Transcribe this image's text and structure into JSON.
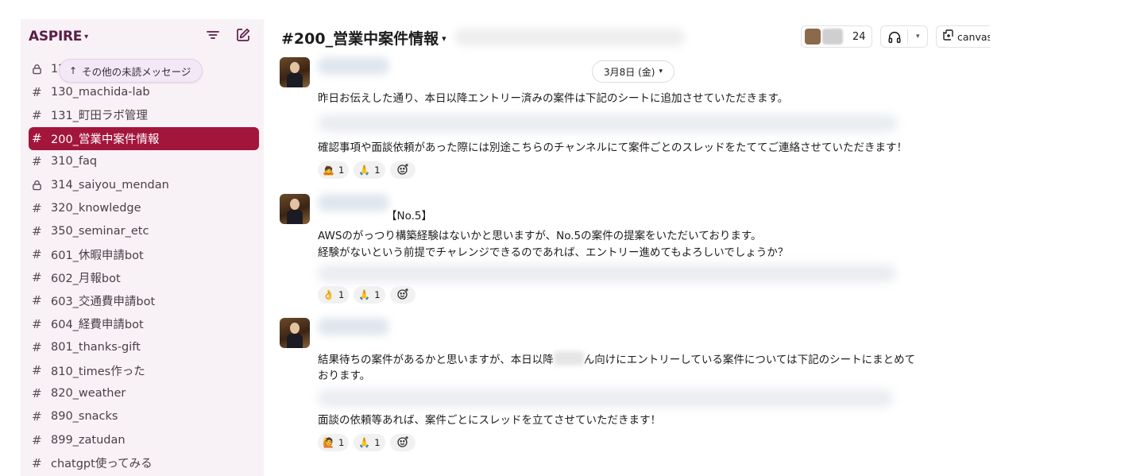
{
  "workspace": {
    "name": "ASPIRE"
  },
  "sidebar": {
    "unread_pill": "その他の未読メッセージ",
    "channels": [
      {
        "label": "12",
        "type": "private"
      },
      {
        "label": "130_machida-lab",
        "type": "public"
      },
      {
        "label": "131_町田ラボ管理",
        "type": "public"
      },
      {
        "label": "200_営業中案件情報",
        "type": "public",
        "active": true
      },
      {
        "label": "310_faq",
        "type": "public"
      },
      {
        "label": "314_saiyou_mendan",
        "type": "private"
      },
      {
        "label": "320_knowledge",
        "type": "public"
      },
      {
        "label": "350_seminar_etc",
        "type": "public"
      },
      {
        "label": "601_休暇申請bot",
        "type": "public"
      },
      {
        "label": "602_月報bot",
        "type": "public"
      },
      {
        "label": "603_交通費申請bot",
        "type": "public"
      },
      {
        "label": "604_経費申請bot",
        "type": "public"
      },
      {
        "label": "801_thanks-gift",
        "type": "public"
      },
      {
        "label": "810_times作った",
        "type": "public"
      },
      {
        "label": "820_weather",
        "type": "public"
      },
      {
        "label": "890_snacks",
        "type": "public"
      },
      {
        "label": "899_zatudan",
        "type": "public"
      },
      {
        "label": "chatgpt使ってみる",
        "type": "public"
      }
    ]
  },
  "header": {
    "hash": "#",
    "channel_name": "200_営業中案件情報",
    "member_count": "24",
    "canvas_label": "canvas"
  },
  "date_divider": "3月8日 (金)",
  "messages": [
    {
      "lines": [
        "昨日お伝えした通り、本日以降エントリー済みの案件は下記のシートに追加させていただきます。",
        "確認事項や面談依頼があった際には別途こちらのチャンネルにて案件ごとのスレッドをたててご連絡させていただきます！"
      ],
      "reactions": [
        {
          "emoji": "🙇",
          "count": "1"
        },
        {
          "emoji": "🙏",
          "count": "1"
        }
      ]
    },
    {
      "tag": "【No.5】",
      "lines": [
        "AWSのがっつり構築経験はないかと思いますが、No.5の案件の提案をいただいております。",
        "経験がないという前提でチャレンジできるのであれば、エントリー進めてもよろしいでしょうか？"
      ],
      "reactions": [
        {
          "emoji": "👌",
          "count": "1"
        },
        {
          "emoji": "🙏",
          "count": "1"
        }
      ]
    },
    {
      "line1_before": "結果待ちの案件があるかと思いますが、本日以降",
      "line1_after": "ん向けにエントリーしている案件については下記のシートにまとめて",
      "line2": "おります。",
      "line3": "面談の依頼等あれば、案件ごとにスレッドを立てさせていただきます！",
      "reactions": [
        {
          "emoji": "🙋",
          "count": "1"
        },
        {
          "emoji": "🙏",
          "count": "1"
        }
      ]
    }
  ],
  "icons": {
    "filter": "filter-icon",
    "compose": "compose-icon",
    "headphones": "headphones-icon",
    "canvas": "canvas-icon",
    "add_reaction": "add-reaction-icon",
    "lock": "lock-icon",
    "hash": "hash-icon"
  },
  "colors": {
    "sidebar_bg": "#f8f1f6",
    "active_channel": "#a3163c",
    "workspace_name": "#5b1d4a"
  }
}
